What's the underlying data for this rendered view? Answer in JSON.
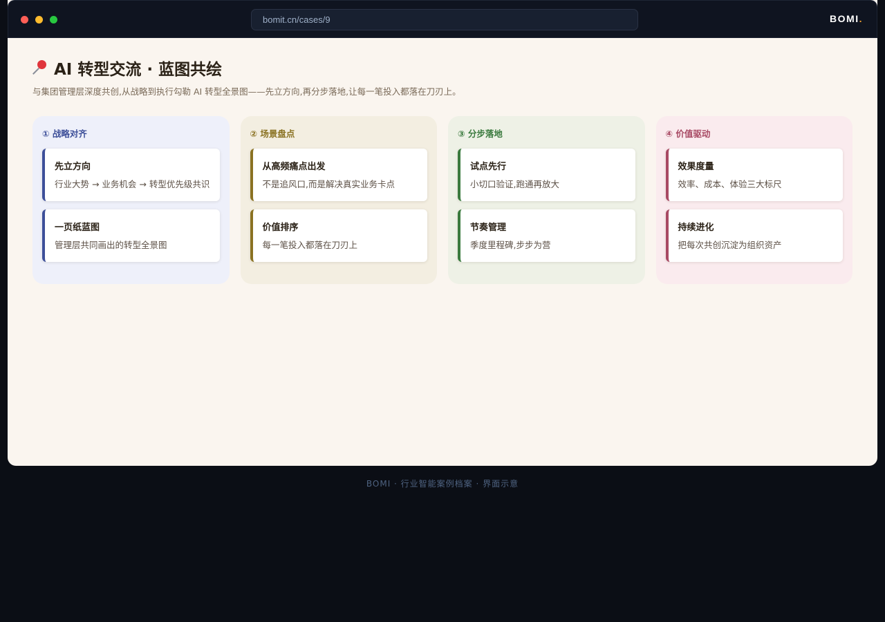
{
  "window": {
    "url": "bomit.cn/cases/9",
    "brand": "BOMI",
    "brand_dot": ".",
    "colors": {
      "titlebar": "#0f1420",
      "page_bg": "#faf5ef",
      "outer_bg": "#0b0e15"
    }
  },
  "header": {
    "icon": "pushpin-icon",
    "title": "AI 转型交流 · 蓝图共绘",
    "subtitle": "与集团管理层深度共创,从战略到执行勾勒 AI 转型全景图——先立方向,再分步落地,让每一笔投入都落在刀刃上。"
  },
  "columns": [
    {
      "title": "① 战略对齐",
      "color": "#3d4f99",
      "bg": "#eef0fa",
      "cards": [
        {
          "title": "先立方向",
          "desc": "行业大势 → 业务机会 → 转型优先级共识"
        },
        {
          "title": "一页纸蓝图",
          "desc": "管理层共同画出的转型全景图"
        }
      ]
    },
    {
      "title": "② 场景盘点",
      "color": "#8a7222",
      "bg": "#f3eee1",
      "cards": [
        {
          "title": "从高频痛点出发",
          "desc": "不是追风口,而是解决真实业务卡点"
        },
        {
          "title": "价值排序",
          "desc": "每一笔投入都落在刀刃上"
        }
      ]
    },
    {
      "title": "③ 分步落地",
      "color": "#3a7a3e",
      "bg": "#eef1e6",
      "cards": [
        {
          "title": "试点先行",
          "desc": "小切口验证,跑通再放大"
        },
        {
          "title": "节奏管理",
          "desc": "季度里程碑,步步为营"
        }
      ]
    },
    {
      "title": "④ 价值驱动",
      "color": "#a84a64",
      "bg": "#faebee",
      "cards": [
        {
          "title": "效果度量",
          "desc": "效率、成本、体验三大标尺"
        },
        {
          "title": "持续进化",
          "desc": "把每次共创沉淀为组织资产"
        }
      ]
    }
  ],
  "footer": {
    "text": "BOMI · 行业智能案例档案 · 界面示意"
  }
}
